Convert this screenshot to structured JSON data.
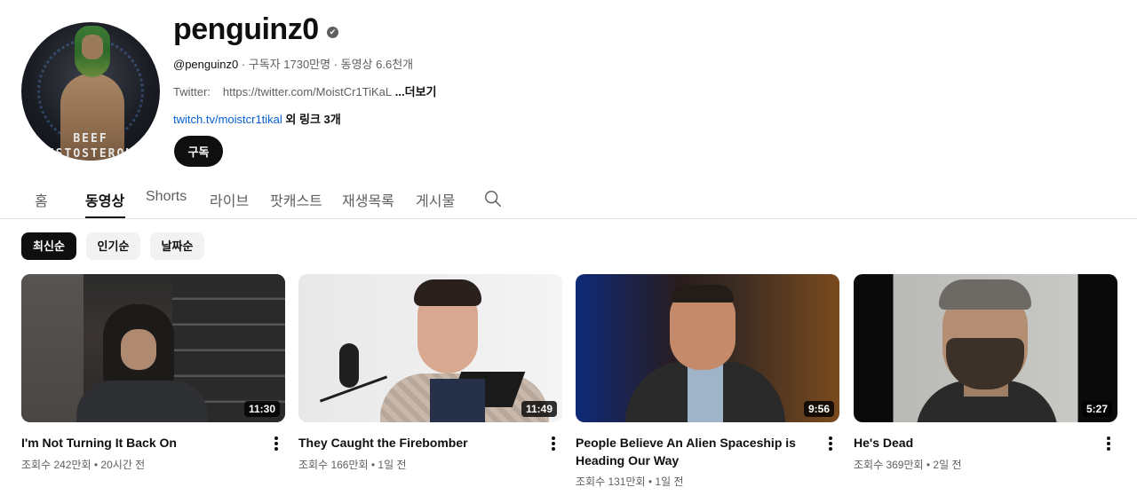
{
  "channel": {
    "name": "penguinz0",
    "verified_icon": "✔",
    "handle": "@penguinz0",
    "meta_rest": " · 구독자 1730만명 · 동영상 6.6천개",
    "desc_label": "Twitter:",
    "desc_text": "https://twitter.com/MoistCr1TiKaL",
    "desc_more": " ...더보기",
    "link_text": "twitch.tv/moistcr1tikal",
    "other_links": " 외 링크 3개",
    "subscribe_label": "구독",
    "avatar_text_1": "BEEF",
    "avatar_text_2": "TESTOSTERONE"
  },
  "tabs": [
    {
      "label": "홈"
    },
    {
      "label": "동영상"
    },
    {
      "label": "Shorts"
    },
    {
      "label": "라이브"
    },
    {
      "label": "팟캐스트"
    },
    {
      "label": "재생목록"
    },
    {
      "label": "게시물"
    }
  ],
  "active_tab": "동영상",
  "chips": [
    {
      "label": "최신순",
      "active": true
    },
    {
      "label": "인기순",
      "active": false
    },
    {
      "label": "날짜순",
      "active": false
    }
  ],
  "videos": [
    {
      "title": "I'm Not Turning It Back On",
      "duration": "11:30",
      "stats": "조회수 242만회 • 20시간 전"
    },
    {
      "title": "They Caught the Firebomber",
      "duration": "11:49",
      "stats": "조회수 166만회 • 1일 전"
    },
    {
      "title": "People Believe An Alien Spaceship is Heading Our Way",
      "duration": "9:56",
      "stats": "조회수 131만회 • 1일 전"
    },
    {
      "title": "He's Dead",
      "duration": "5:27",
      "stats": "조회수 369만회 • 2일 전"
    }
  ],
  "colors": {
    "text": "#0f0f0f",
    "secondary": "#606060",
    "link": "#065fd4",
    "chip_bg": "#f2f2f2"
  }
}
